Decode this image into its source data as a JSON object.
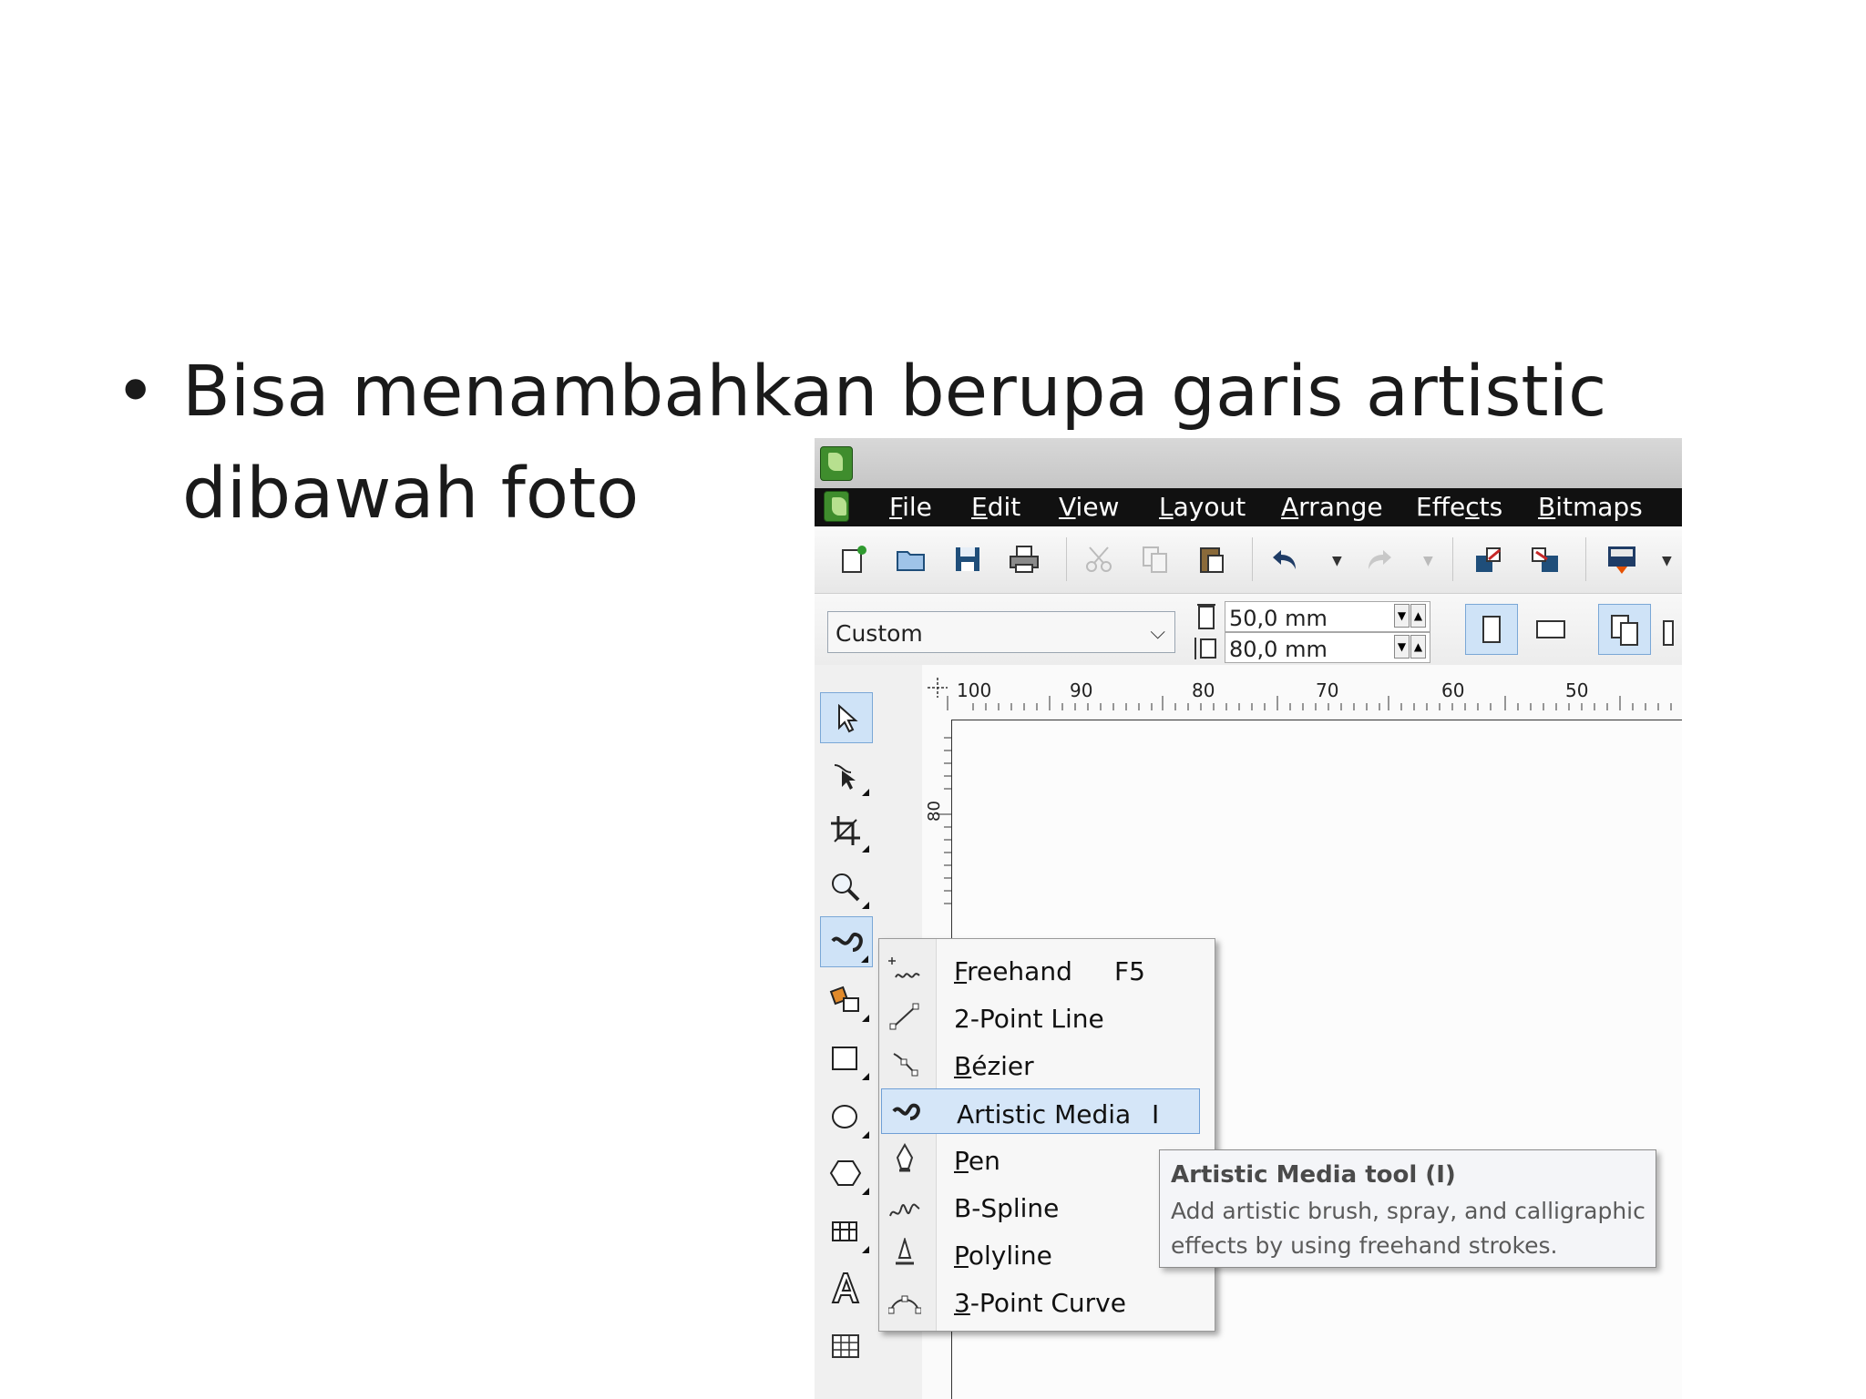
{
  "slide": {
    "bullet": "•",
    "line1": "Bisa menambahkan berupa garis artistic",
    "line2": "dibawah foto"
  },
  "app": {
    "menus": [
      {
        "label": "File",
        "mnemonic": "F",
        "rest": "ile"
      },
      {
        "label": "Edit",
        "mnemonic": "E",
        "rest": "dit"
      },
      {
        "label": "View",
        "mnemonic": "V",
        "rest": "iew"
      },
      {
        "label": "Layout",
        "mnemonic": "L",
        "rest": "ayout"
      },
      {
        "label": "Arrange",
        "mnemonic": "A",
        "rest": "rrange"
      },
      {
        "label": "Effects",
        "pre": "Effe",
        "mnemonic": "c",
        "rest": "ts"
      },
      {
        "label": "Bitmaps",
        "mnemonic": "B",
        "rest": "itmaps"
      }
    ],
    "toolbar": {
      "icons": [
        "new-document-icon",
        "open-folder-icon",
        "save-icon",
        "print-icon",
        "cut-icon",
        "copy-icon",
        "paste-icon",
        "undo-icon",
        "redo-icon",
        "import-icon",
        "export-icon",
        "application-launcher-icon"
      ]
    },
    "property_bar": {
      "page_preset": "Custom",
      "width_value": "50,0 mm",
      "height_value": "80,0 mm"
    },
    "ruler": {
      "top_labels": [
        "100",
        "90",
        "80",
        "70",
        "60",
        "50"
      ],
      "left_label": "80"
    },
    "toolbox": {
      "tools": [
        "pick-tool-icon",
        "shape-tool-icon",
        "crop-tool-icon",
        "zoom-tool-icon",
        "artistic-media-tool-icon",
        "smart-fill-tool-icon",
        "rectangle-tool-icon",
        "ellipse-tool-icon",
        "polygon-tool-icon",
        "table-dimension-tool-icon",
        "text-tool-icon",
        "table-tool-icon"
      ]
    },
    "flyout": {
      "items": [
        {
          "pre": "",
          "mnemonic": "F",
          "rest": "reehand",
          "shortcut": "F5"
        },
        {
          "pre": "2-Point Line",
          "mnemonic": "",
          "rest": "",
          "shortcut": ""
        },
        {
          "pre": "",
          "mnemonic": "B",
          "rest": "ézier",
          "shortcut": ""
        },
        {
          "pre": "Artistic Media",
          "mnemonic": "",
          "rest": "",
          "shortcut": "I"
        },
        {
          "pre": "",
          "mnemonic": "P",
          "rest": "en",
          "shortcut": ""
        },
        {
          "pre": "B-Spline",
          "mnemonic": "",
          "rest": "",
          "shortcut": ""
        },
        {
          "pre": "",
          "mnemonic": "P",
          "rest": "olyline",
          "shortcut": ""
        },
        {
          "pre": "",
          "mnemonic": "3",
          "rest": "-Point Curve",
          "shortcut": ""
        }
      ]
    },
    "tooltip": {
      "title": "Artistic Media tool (I)",
      "description": "Add artistic brush, spray, and calligraphic effects by using freehand strokes."
    }
  }
}
